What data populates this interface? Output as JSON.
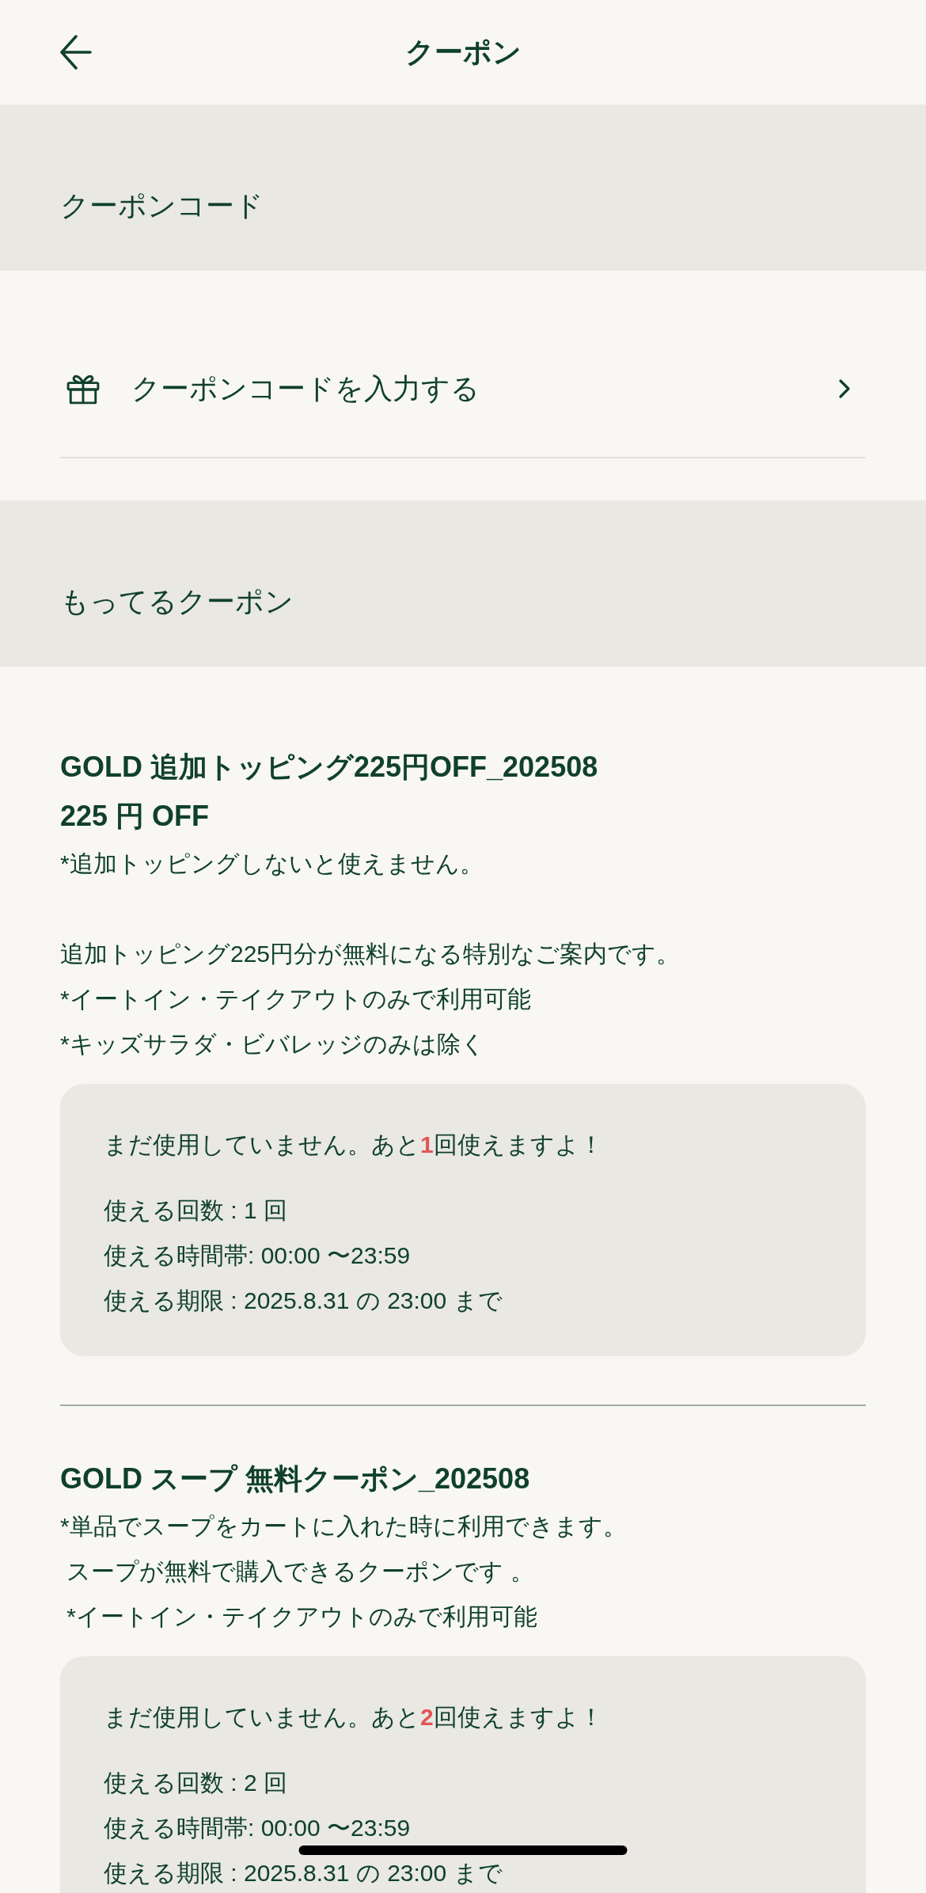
{
  "header": {
    "title": "クーポン"
  },
  "coupon_code_section": {
    "heading": "クーポンコード",
    "entry": {
      "label": "クーポンコードを入力する"
    }
  },
  "owned_coupons_section": {
    "heading": "もってるクーポン",
    "coupons": [
      {
        "title": "GOLD 追加トッピング225円OFF_202508",
        "discount": "225 円 OFF",
        "paragraphs": [
          [
            "*追加トッピングしないと使えません。"
          ],
          [
            "追加トッピング225円分が無料になる特別なご案内です。",
            "*イートイン・テイクアウトのみで利用可能",
            "*キッズサラダ・ビバレッジのみは除く"
          ]
        ],
        "usage": {
          "status": "まだ使用していません。あと**1**回使えますよ！",
          "details": [
            "使える回数 : 1 回",
            "使える時間帯: 00:00 〜23:59",
            "使える期限 : 2025.8.31 の 23:00 まで"
          ]
        }
      },
      {
        "title": "GOLD スープ 無料クーポン_202508",
        "paragraphs": [
          [
            "*単品でスープをカートに入れた時に利用できます。",
            " スープが無料で購入できるクーポンです 。",
            " *イートイン・テイクアウトのみで利用可能"
          ]
        ],
        "usage": {
          "status": "まだ使用していません。あと**2**回使えますよ！",
          "details": [
            "使える回数 : 2 回",
            "使える時間帯: 00:00 〜23:59",
            "使える期限 : 2025.8.31 の 23:00 まで"
          ]
        }
      }
    ]
  }
}
